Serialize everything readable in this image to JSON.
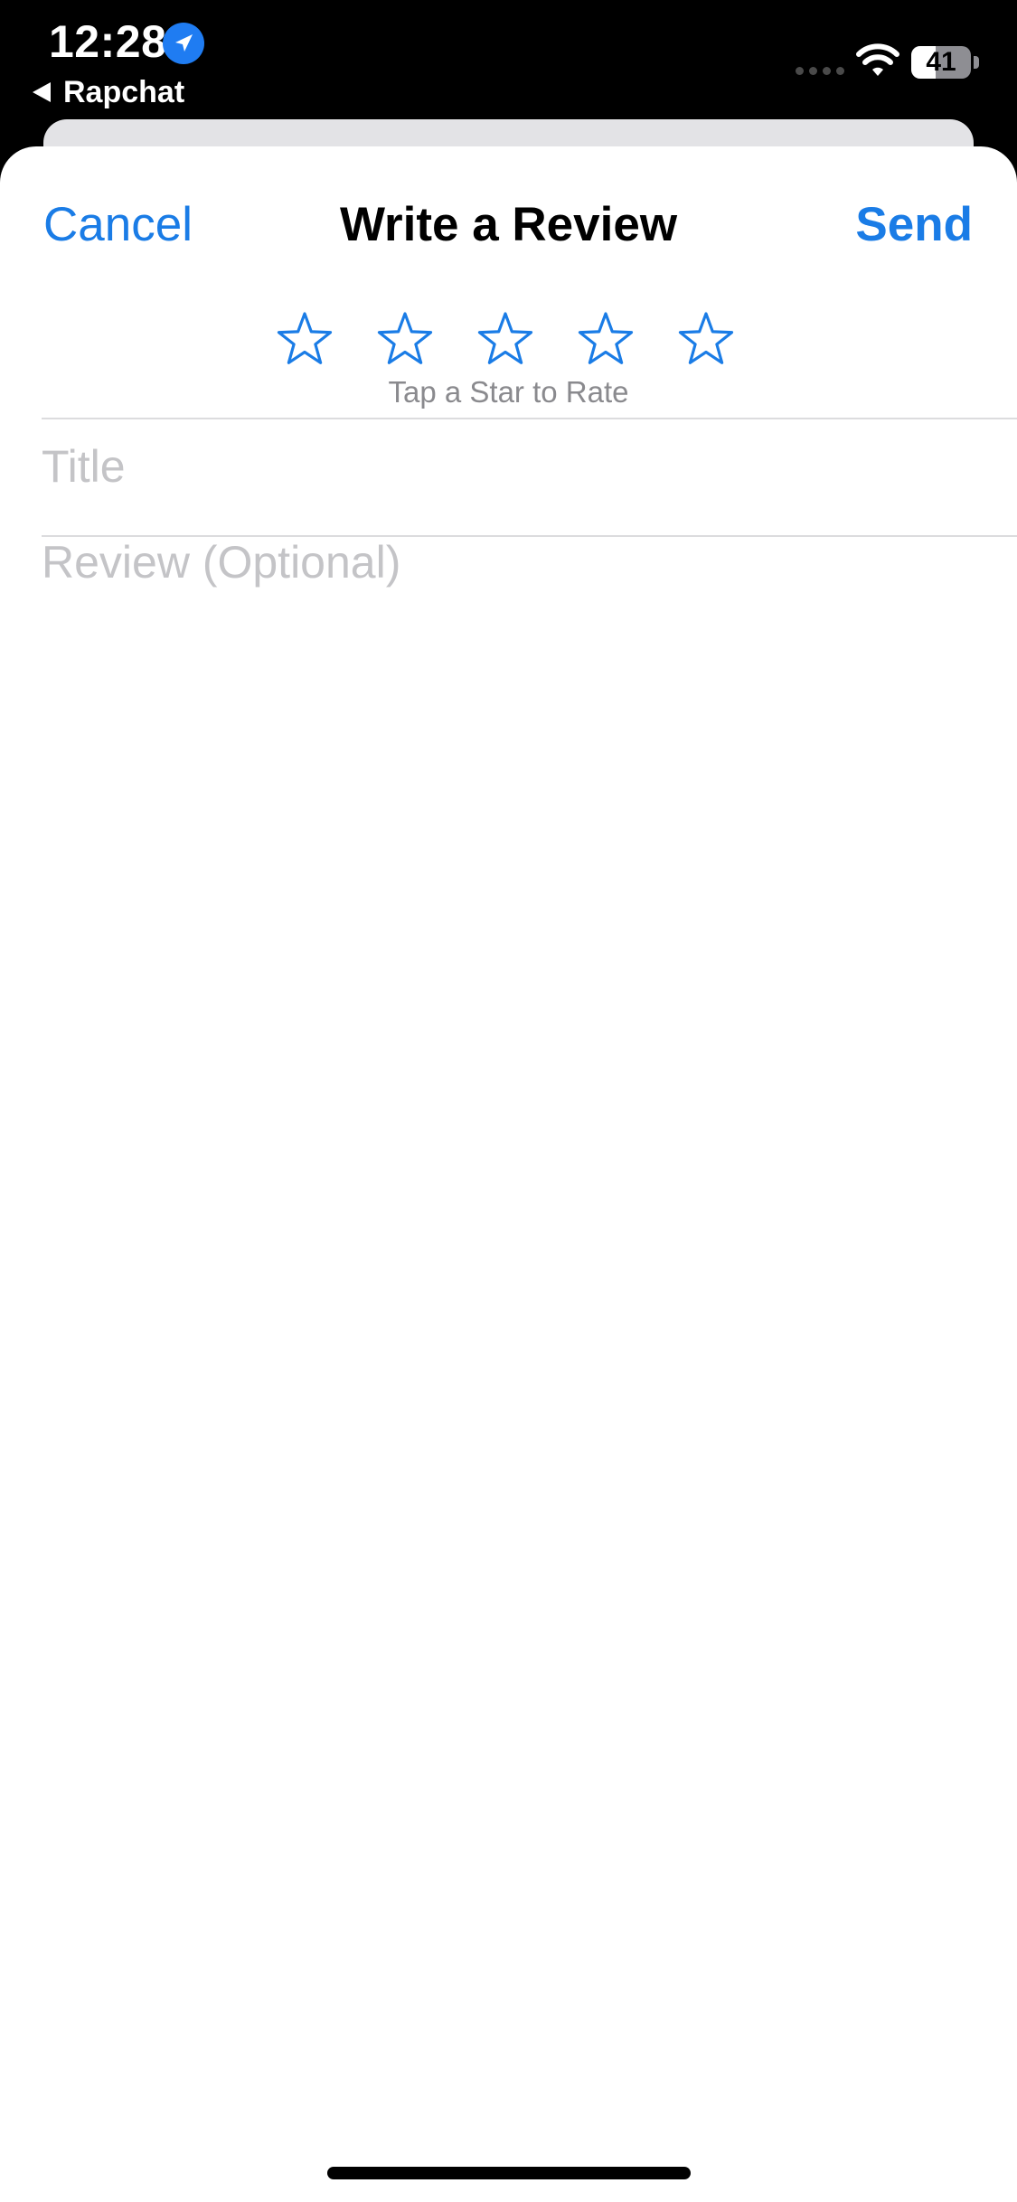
{
  "status_bar": {
    "time": "12:28",
    "location_icon": "location-arrow-icon",
    "back_app_label": "Rapchat",
    "wifi_icon": "wifi-icon",
    "battery_level": 41,
    "battery_text": "41"
  },
  "sheet": {
    "cancel_label": "Cancel",
    "title": "Write a Review",
    "send_label": "Send",
    "rating": {
      "stars_total": 5,
      "stars_selected": 0,
      "star_icon": "star-outline-icon",
      "hint": "Tap a Star to Rate"
    },
    "title_field": {
      "placeholder": "Title",
      "value": ""
    },
    "review_field": {
      "placeholder": "Review (Optional)",
      "value": ""
    }
  },
  "colors": {
    "accent": "#1a7ce6",
    "placeholder": "#c4c4c7",
    "hint": "#8a8a8e",
    "divider": "#dcdcde"
  }
}
